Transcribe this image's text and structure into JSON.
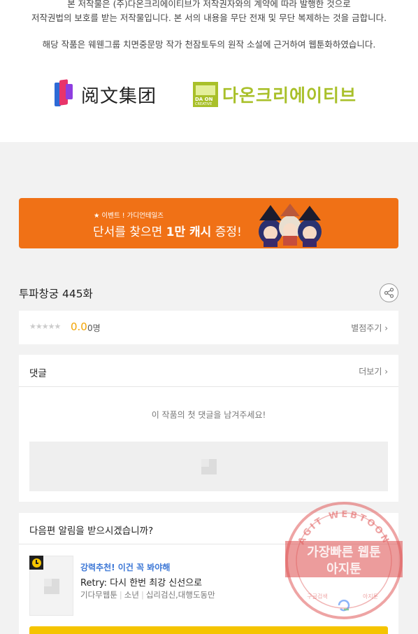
{
  "copyright": {
    "line1": "본 저작물은 (주)다온크리에이티브가 저작권자와의 계약에 따라 발행한 것으로",
    "line2": "저작권법의 보호를 받는 저작물입니다. 본 서의 내용을 무단 전재 및 무단 복제하는 것을 금합니다.",
    "line3": "해당 작품은 웨웬그룹 치면중문망 작가 천잠토두의 원작 소설에 근거하여 웹툰화하였습니다."
  },
  "logos": {
    "yuewen": "阅文集团",
    "daon_small_1": "DA ON",
    "daon_small_2": "CREATIVE",
    "daon": "다온크리에이티브"
  },
  "banner": {
    "sub": "★ 이벤트 ! 가디언테일즈",
    "main_a": "단서를 찾으면 ",
    "main_b": "1만 캐시",
    "main_c": " 증정!"
  },
  "episode": {
    "title": "투파창궁 445화"
  },
  "rating": {
    "stars": "★★★★★",
    "score": "0.0",
    "count": "0명",
    "rate_label": "별점주기 ›",
    "rating_value": 0
  },
  "comments": {
    "title": "댓글",
    "more": "더보기 ›",
    "empty": "이 작품의 첫 댓글을 남겨주세요!"
  },
  "next": {
    "title": "다음편 알림을 받으시겠습니까?",
    "tag": "강력추천! 이건 꼭 봐야해",
    "rec_title": "Retry: 다시 한번 최강 신선으로",
    "meta_1": "기다무웹툰",
    "meta_2": "소년",
    "meta_3": "십리검신,대행도동만"
  },
  "watermark": {
    "top": "AGIT WEBTOON",
    "line1": "가장빠른 웹툰",
    "line2": "아지툰",
    "bottom_left": "구글검색",
    "bottom_right": "아지툰"
  },
  "colors": {
    "banner": "#f07116",
    "score": "#f2a404",
    "recommend": "#3c77d6",
    "cta": "#f5c400",
    "daon": "#a9c02a",
    "watermark": "#e05a5a"
  }
}
